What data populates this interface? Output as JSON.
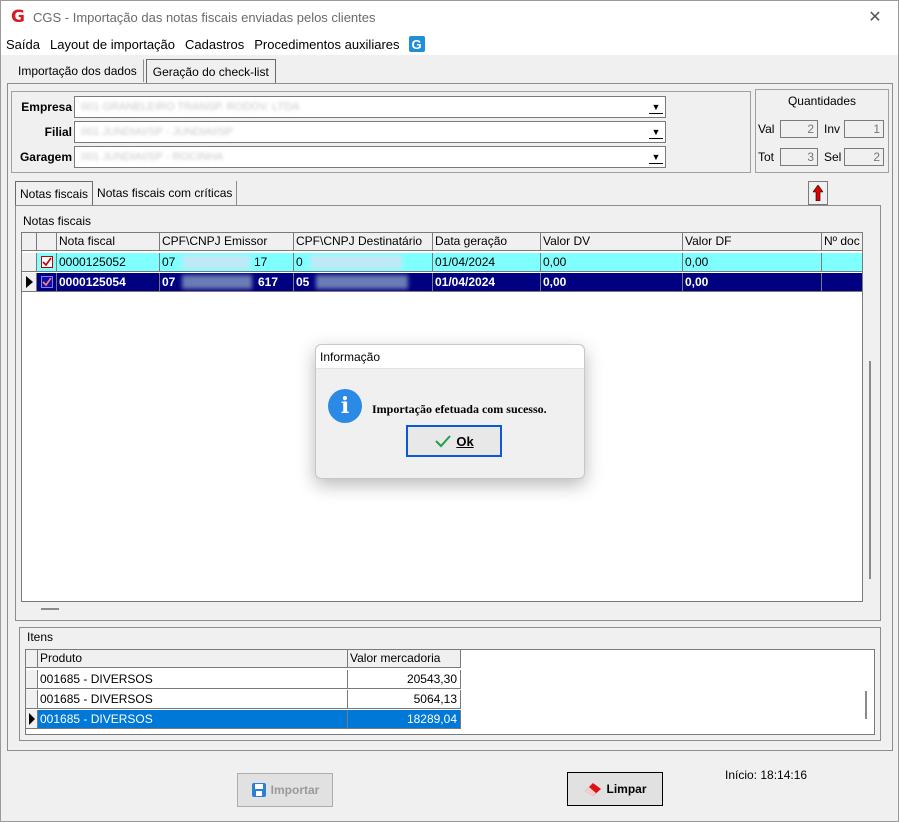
{
  "window": {
    "title": "CGS - Importação das notas fiscais enviadas pelos clientes",
    "close_glyph": "✕",
    "logo_glyph": "G"
  },
  "menu": {
    "items": [
      "Saída",
      "Layout de importação",
      "Cadastros",
      "Procedimentos auxiliares"
    ],
    "g_glyph": "G"
  },
  "top_tabs": [
    {
      "label": "Importação dos dados",
      "active": false
    },
    {
      "label": "Geração do check-list",
      "active": true
    }
  ],
  "filters": {
    "empresa": {
      "label": "Empresa",
      "value": "001 GRANELEIRO TRANSP. RODOV. LTDA"
    },
    "filial": {
      "label": "Filial",
      "value": "001 JUNDIAI/SP - JUNDIAI/SP"
    },
    "garagem": {
      "label": "Garagem",
      "value": "001 JUNDIAI/SP - ROCINHA"
    }
  },
  "quantidades": {
    "title": "Quantidades",
    "val": {
      "label": "Val",
      "value": "2"
    },
    "inv": {
      "label": "Inv",
      "value": "1"
    },
    "tot": {
      "label": "Tot",
      "value": "3"
    },
    "sel": {
      "label": "Sel",
      "value": "2"
    }
  },
  "inner_tabs": [
    {
      "label": "Notas fiscais",
      "active": true
    },
    {
      "label": "Notas fiscais com críticas",
      "active": false
    }
  ],
  "notas": {
    "group_title": "Notas fiscais",
    "columns": [
      "Nota fiscal",
      "CPF\\CNPJ Emissor",
      "CPF\\CNPJ Destinatário",
      "Data geração",
      "Valor DV",
      "Valor DF",
      "Nº doc"
    ],
    "rows": [
      {
        "nota": "0000125052",
        "emissor_start": "07",
        "emissor_end": "17",
        "dest_start": "0",
        "data": "01/04/2024",
        "valor_dv": "0,00",
        "valor_df": "0,00",
        "doc": "",
        "selected": false
      },
      {
        "nota": "0000125054",
        "emissor_start": "07",
        "emissor_end": "617",
        "dest_start": "05",
        "data": "01/04/2024",
        "valor_dv": "0,00",
        "valor_df": "0,00",
        "doc": "",
        "selected": true
      }
    ]
  },
  "itens": {
    "group_title": "Itens",
    "columns": [
      "Produto",
      "Valor mercadoria"
    ],
    "rows": [
      {
        "produto": "001685 - DIVERSOS",
        "valor": "20543,30",
        "selected": false
      },
      {
        "produto": "001685 - DIVERSOS",
        "valor": "5064,13",
        "selected": false
      },
      {
        "produto": "001685 - DIVERSOS",
        "valor": "18289,04",
        "selected": true
      }
    ]
  },
  "buttons": {
    "importar": "Importar",
    "limpar": "Limpar"
  },
  "status": {
    "inicio": "Início: 18:14:16"
  },
  "dialog": {
    "title": "Informação",
    "message": "Importação efetuada com sucesso.",
    "ok": "Ok",
    "icon_glyph": "i"
  },
  "colors": {
    "row_highlight": "#80ffff",
    "row_selected": "#000080",
    "item_selected": "#0078d7",
    "logo_red": "#d71920"
  }
}
